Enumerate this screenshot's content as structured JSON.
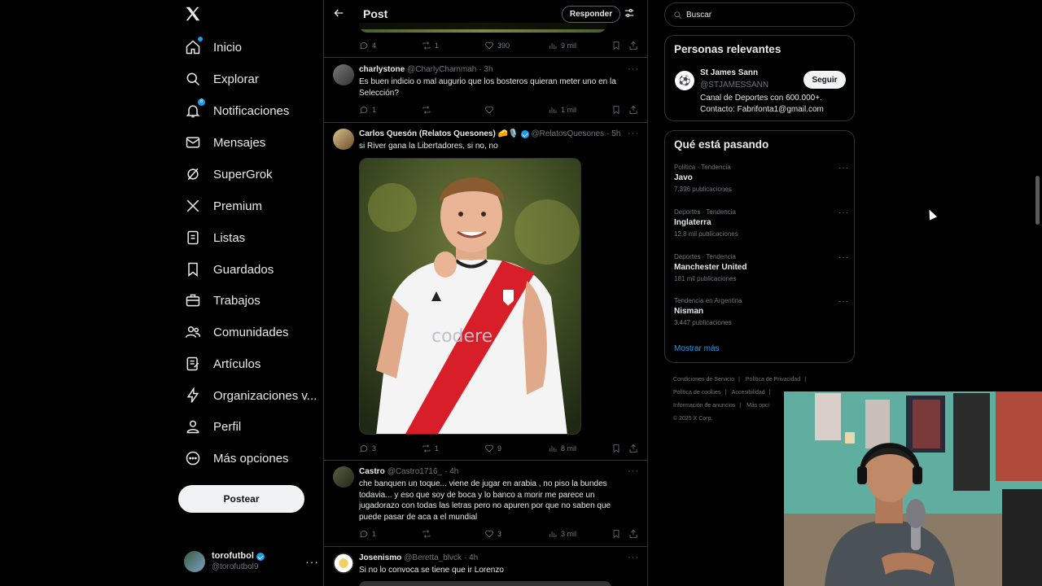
{
  "nav": {
    "items": [
      {
        "label": "Inicio",
        "icon": "home-icon"
      },
      {
        "label": "Explorar",
        "icon": "search-icon"
      },
      {
        "label": "Notificaciones",
        "icon": "bell-icon"
      },
      {
        "label": "Mensajes",
        "icon": "mail-icon"
      },
      {
        "label": "SuperGrok",
        "icon": "grok-icon"
      },
      {
        "label": "Premium",
        "icon": "x-icon"
      },
      {
        "label": "Listas",
        "icon": "list-icon"
      },
      {
        "label": "Guardados",
        "icon": "bookmark-icon"
      },
      {
        "label": "Trabajos",
        "icon": "briefcase-icon"
      },
      {
        "label": "Comunidades",
        "icon": "people-icon"
      },
      {
        "label": "Artículos",
        "icon": "article-icon"
      },
      {
        "label": "Organizaciones v...",
        "icon": "lightning-icon"
      },
      {
        "label": "Perfil",
        "icon": "person-icon"
      },
      {
        "label": "Más opciones",
        "icon": "more-circle-icon"
      }
    ],
    "notifications_badge": "8",
    "post_button": "Postear",
    "account": {
      "name": "torofutbol",
      "handle": "@torofutbol9"
    }
  },
  "header": {
    "title": "Post",
    "reply_button": "Responder"
  },
  "top_actions": {
    "replies": "4",
    "reposts": "1",
    "likes": "390",
    "views": "9 mil"
  },
  "tweets": [
    {
      "name": "charlystone",
      "handle": "@CharlyChammah",
      "time": "· 3h",
      "text": "Es buen indicio o mal augurio que los bosteros quieran meter uno en la Selección?",
      "replies": "1",
      "reposts": "",
      "likes": "",
      "views": "1 mil"
    },
    {
      "name": "Carlos Quesón (Relatos Quesones) 🧀🎙️",
      "handle": "@RelatosQuesones",
      "time": "· 5h",
      "text": "si River gana la Libertadores, si no, no",
      "media_sponsor": "codere",
      "replies": "3",
      "reposts": "1",
      "likes": "9",
      "views": "8 mil"
    },
    {
      "name": "Castro",
      "handle": "@Castro1716_",
      "time": "· 4h",
      "text": "che banquen un toque... viene de jugar en arabia , no piso la bundes todavia... y eso que soy de boca y lo banco a morir me parece un jugadorazo con todas las letras pero no apuren por que no saben que puede pasar de aca a el mundial",
      "replies": "1",
      "reposts": "",
      "likes": "3",
      "views": "3 mil"
    },
    {
      "name": "Josenismo",
      "handle": "@Beretta_blvck",
      "time": "· 4h",
      "text": "Si no lo convoca se tiene que ir Lorenzo"
    }
  ],
  "search": {
    "placeholder": "Buscar"
  },
  "relevant": {
    "title": "Personas relevantes",
    "name": "St James Sann",
    "handle": "@STJAMESSANN",
    "bio": "Canal de Deportes con 600.000+. Contacto: Fabrifonta1@gmail.com",
    "follow": "Seguir"
  },
  "trending": {
    "title": "Qué está pasando",
    "items": [
      {
        "category": "Política · Tendencia",
        "name": "Javo",
        "count": "7.396 publicaciones"
      },
      {
        "category": "Deportes · Tendencia",
        "name": "Inglaterra",
        "count": "12,8 mil publicaciones"
      },
      {
        "category": "Deportes · Tendencia",
        "name": "Manchester United",
        "count": "181 mil publicaciones"
      },
      {
        "category": "Tendencia en Argentina",
        "name": "Nisman",
        "count": "3.447 publicaciones"
      }
    ],
    "show_more": "Mostrar más"
  },
  "footer": {
    "links": [
      "Condiciones de Servicio",
      "|",
      "Política de Privacidad",
      "|",
      "Política de cookies",
      "|",
      "Accesibilidad",
      "|",
      "Información de anuncios",
      "|",
      "Más opci"
    ],
    "copyright": "© 2025 X Corp."
  },
  "colors": {
    "accent": "#1d9bf0",
    "background": "#000000",
    "text": "#e7e9ea",
    "muted": "#71767b",
    "border": "#2f3336"
  }
}
